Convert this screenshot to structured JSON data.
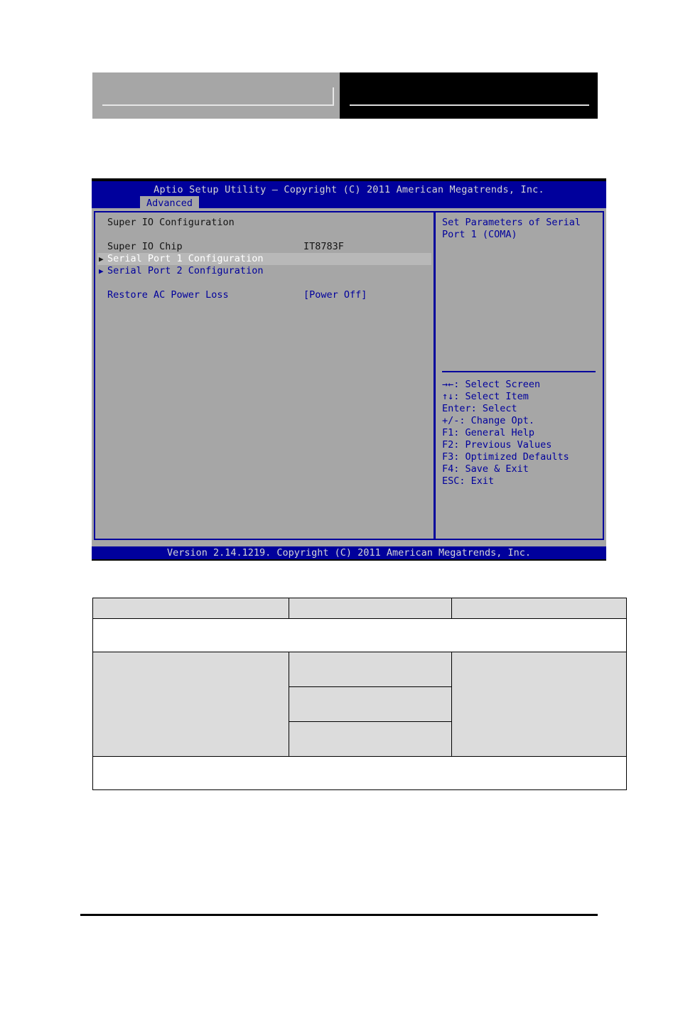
{
  "bios": {
    "title": "Aptio Setup Utility – Copyright (C) 2011 American Megatrends, Inc.",
    "tabs": [
      {
        "label": "Advanced",
        "active": true
      }
    ],
    "section_heading": "Super IO Configuration",
    "options": [
      {
        "label": "Super IO Chip",
        "value": "IT8783F",
        "arrow": "",
        "style": "dark",
        "highlighted": false
      },
      {
        "label": "Serial Port 1 Configuration",
        "value": "",
        "arrow": "▶",
        "style": "blue",
        "highlighted": true
      },
      {
        "label": "Serial Port 2 Configuration",
        "value": "",
        "arrow": "▶",
        "style": "blue",
        "highlighted": false
      },
      {
        "label": "Restore AC Power Loss",
        "value": "[Power Off]",
        "arrow": "",
        "style": "blue",
        "highlighted": false
      }
    ],
    "help_text": "Set Parameters of Serial Port 1 (COMA)",
    "key_legend": [
      "→←: Select Screen",
      "↑↓: Select Item",
      "Enter: Select",
      "+/-: Change Opt.",
      "F1: General Help",
      "F2: Previous Values",
      "F3: Optimized Defaults",
      "F4: Save & Exit",
      "ESC: Exit"
    ],
    "footer": "Version 2.14.1219. Copyright (C) 2011 American Megatrends, Inc.",
    "colors": {
      "screen_blue": "#00009c",
      "screen_gray": "#a6a6a6",
      "highlight_gray": "#b8b8b8",
      "title_text": "#d4d4d4",
      "dark_text": "#141414"
    }
  },
  "header": {
    "box_left_label": "",
    "box_right_label": ""
  },
  "spec_table": {
    "rows": [
      {
        "cells": [
          {
            "text": "",
            "fill": "gray",
            "colspan": 1,
            "rowspan": 1
          },
          {
            "text": "",
            "fill": "gray",
            "colspan": 1,
            "rowspan": 1
          },
          {
            "text": "",
            "fill": "gray",
            "colspan": 1,
            "rowspan": 1
          }
        ]
      },
      {
        "cells": [
          {
            "text": "",
            "fill": "white",
            "colspan": 3,
            "rowspan": 1
          }
        ]
      },
      {
        "cells": [
          {
            "text": "",
            "fill": "gray",
            "colspan": 1,
            "rowspan": 3
          },
          {
            "text": "",
            "fill": "gray",
            "colspan": 1,
            "rowspan": 1
          },
          {
            "text": "",
            "fill": "gray",
            "colspan": 1,
            "rowspan": 3
          }
        ]
      },
      {
        "cells": [
          {
            "text": "",
            "fill": "gray",
            "colspan": 1,
            "rowspan": 1
          }
        ]
      },
      {
        "cells": [
          {
            "text": "",
            "fill": "gray",
            "colspan": 1,
            "rowspan": 1
          }
        ]
      },
      {
        "cells": [
          {
            "text": "",
            "fill": "white",
            "colspan": 3,
            "rowspan": 1
          }
        ]
      }
    ]
  }
}
